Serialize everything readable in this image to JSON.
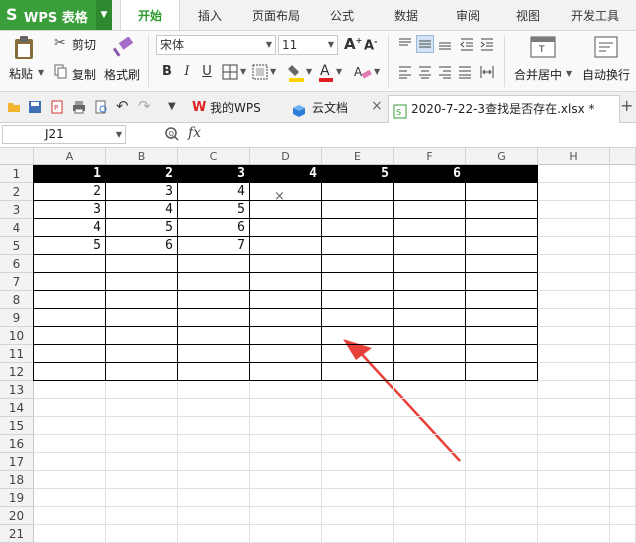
{
  "app": {
    "logo": "S",
    "name": "WPS 表格"
  },
  "menus": [
    "开始",
    "插入",
    "页面布局",
    "公式",
    "数据",
    "审阅",
    "视图",
    "开发工具"
  ],
  "active_menu": "开始",
  "ribbon": {
    "paste": "粘贴",
    "cut": "剪切",
    "copy": "复制",
    "format_painter": "格式刷",
    "font_name": "宋体",
    "font_size": "11",
    "bold": "B",
    "italic": "I",
    "underline": "U",
    "merge_center": "合并居中",
    "wrap_text": "自动换行"
  },
  "tabs": [
    {
      "label": "我的WPS",
      "active": false
    },
    {
      "label": "云文档",
      "active": false
    },
    {
      "label": "2020-7-22-3查找是否存在.xlsx *",
      "active": true
    }
  ],
  "formula_bar": {
    "cell_ref": "J21",
    "fx": "fx"
  },
  "columns": [
    "A",
    "B",
    "C",
    "D",
    "E",
    "F",
    "G",
    "H"
  ],
  "rows": [
    "1",
    "2",
    "3",
    "4",
    "5",
    "6",
    "7",
    "8",
    "9",
    "10",
    "11",
    "12",
    "13",
    "14",
    "15",
    "16",
    "17",
    "18",
    "19",
    "20",
    "21"
  ],
  "cells": [
    [
      "1",
      "2",
      "3",
      "4",
      "5",
      "6"
    ],
    [
      "2",
      "3",
      "4",
      "",
      "",
      ""
    ],
    [
      "3",
      "4",
      "5",
      "",
      "",
      ""
    ],
    [
      "4",
      "5",
      "6",
      "",
      "",
      ""
    ],
    [
      "5",
      "6",
      "7",
      "",
      "",
      ""
    ]
  ],
  "colors": {
    "accent": "#2e9b2e",
    "annotation": "#e8413a",
    "header_fill": "#000000"
  }
}
